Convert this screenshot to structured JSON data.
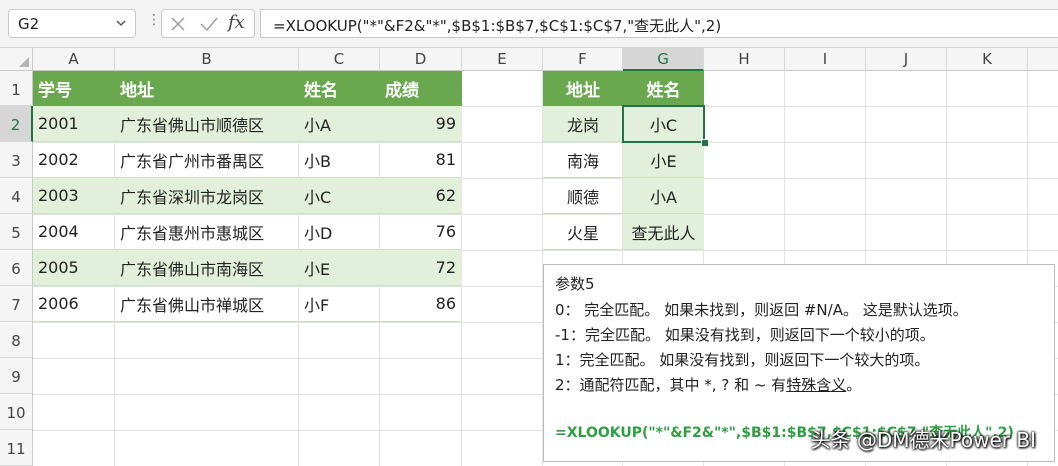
{
  "formula_bar": {
    "name_box": "G2",
    "formula": "=XLOOKUP(\"*\"&F2&\"*\",$B$1:$B$7,$C$1:$C$7,\"查无此人\",2)",
    "fx_label": "fx"
  },
  "columns": [
    "A",
    "B",
    "C",
    "D",
    "E",
    "F",
    "G",
    "H",
    "I",
    "J",
    "K"
  ],
  "rows": [
    "1",
    "2",
    "3",
    "4",
    "5",
    "6",
    "7",
    "8",
    "9",
    "10",
    "11"
  ],
  "main_table": {
    "headers": [
      "学号",
      "地址",
      "姓名",
      "成绩"
    ],
    "rows": [
      [
        "2001",
        "广东省佛山市顺德区",
        "小A",
        "99"
      ],
      [
        "2002",
        "广东省广州市番禺区",
        "小B",
        "81"
      ],
      [
        "2003",
        "广东省深圳市龙岗区",
        "小C",
        "62"
      ],
      [
        "2004",
        "广东省惠州市惠城区",
        "小D",
        "76"
      ],
      [
        "2005",
        "广东省佛山市南海区",
        "小E",
        "72"
      ],
      [
        "2006",
        "广东省佛山市禅城区",
        "小F",
        "86"
      ]
    ]
  },
  "lookup_table": {
    "headers": [
      "地址",
      "姓名"
    ],
    "rows": [
      [
        "龙岗",
        "小C"
      ],
      [
        "南海",
        "小E"
      ],
      [
        "顺德",
        "小A"
      ],
      [
        "火星",
        "查无此人"
      ]
    ]
  },
  "note": {
    "title": "参数5",
    "lines": [
      "0： 完全匹配。 如果未找到，则返回 #N/A。 这是默认选项。",
      "-1：完全匹配。 如果没有找到，则返回下一个较小的项。",
      "1：完全匹配。 如果没有找到，则返回下一个较大的项。"
    ],
    "line4_prefix": "2：通配符匹配，其中 *, ? 和 ~ 有",
    "line4_underlined": "特殊含义",
    "line4_suffix": "。",
    "formula": "=XLOOKUP(\"*\"&F2&\"*\",$B$1:$B$7,$C$1:$C$7,\"查无此人\",2)"
  },
  "watermark": "头条 @DM德米Power BI",
  "colors": {
    "header_green": "#6aa84f",
    "band_green": "#e2efda",
    "excel_green": "#217346",
    "formula_green": "#2ea043"
  }
}
